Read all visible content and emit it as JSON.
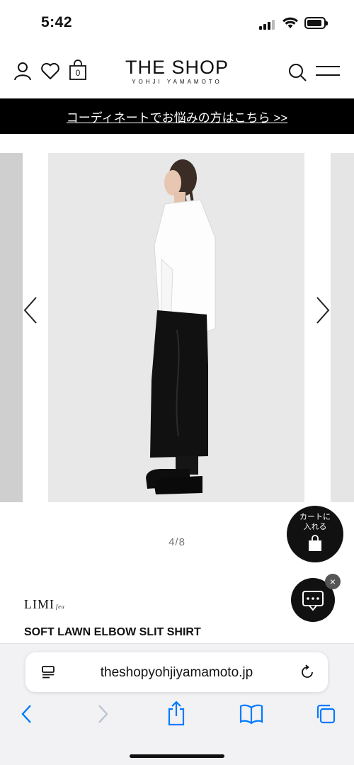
{
  "status_bar": {
    "time": "5:42"
  },
  "header": {
    "brand_title": "THE SHOP",
    "brand_subtitle": "YOHJI YAMAMOTO",
    "cart_count": "0"
  },
  "banner": {
    "text": "コーディネートでお悩みの方はこちら >>"
  },
  "carousel": {
    "counter": "4/8"
  },
  "floating": {
    "cart_line1": "カートに",
    "cart_line2": "入れる",
    "chat_close": "×"
  },
  "product": {
    "brand_logo": "LIMI",
    "brand_logo_suffix": "feu",
    "name": "SOFT LAWN ELBOW SLIT SHIRT"
  },
  "browser": {
    "url": "theshopyohjiyamamoto.jp"
  },
  "colors": {
    "accent": "#007aff",
    "banner_bg": "#000000"
  }
}
